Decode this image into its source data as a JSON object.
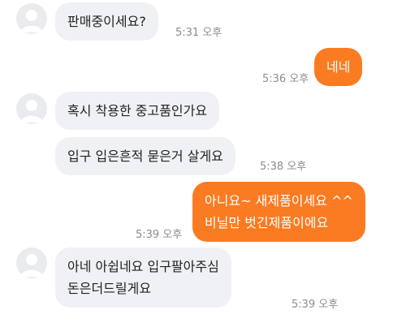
{
  "chat": {
    "messages": [
      {
        "id": "m1",
        "sender": "other",
        "lines": [
          "판매중이세요?"
        ],
        "time": "5:31 오후"
      },
      {
        "id": "m2",
        "sender": "me",
        "lines": [
          "네네"
        ],
        "time": "5:36 오후"
      },
      {
        "id": "m3",
        "sender": "other",
        "lines": [
          "혹시 착용한 중고품인가요"
        ]
      },
      {
        "id": "m4",
        "sender": "other",
        "lines": [
          "입구 입은흔적 묻은거 살게요"
        ],
        "time": "5:38 오후"
      },
      {
        "id": "m5",
        "sender": "me",
        "lines": [
          "아니요~ 새제품이세요 ^^",
          "비닐만 벗긴제품이에요"
        ],
        "time": "5:39 오후"
      },
      {
        "id": "m6",
        "sender": "other",
        "lines": [
          "아네 아쉽네요 입구팔아주심",
          "돈은더드릴게요"
        ],
        "time": "5:39 오후"
      }
    ]
  },
  "colors": {
    "incoming_bubble": "#f0f1f4",
    "outgoing_bubble": "#fb7b22",
    "timestamp": "#8c8c8c"
  },
  "icons": {
    "avatar": "user-avatar-icon"
  }
}
